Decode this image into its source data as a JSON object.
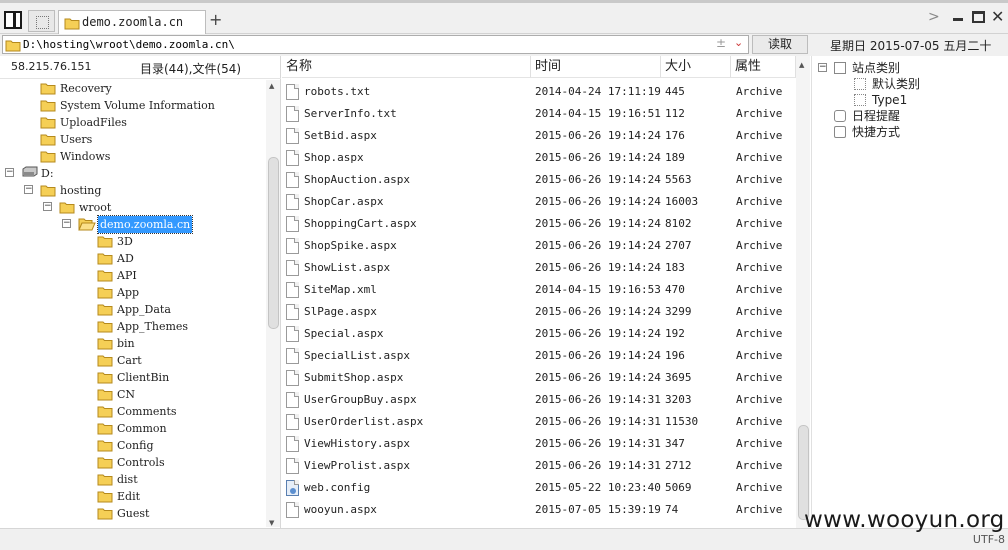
{
  "tab": {
    "label": "demo.zoomla.cn",
    "add_glyph": "+"
  },
  "window": {
    "chevron": ">",
    "close": "✕"
  },
  "address": {
    "path": "D:\\hosting\\wroot\\demo.zoomla.cn\\",
    "plus": "±",
    "dropdown": "⌄",
    "read_label": "读取"
  },
  "datetime": "星期日 2015-07-05 五月二十",
  "left": {
    "ip": "58.215.76.151",
    "count": "目录(44),文件(54)",
    "scroll_up": "▲",
    "scroll_down": "▼",
    "tree": [
      {
        "label": "Recovery",
        "depth": 2,
        "toggle": "",
        "selected": false,
        "icon": "folder"
      },
      {
        "label": "System Volume Information",
        "depth": 2,
        "toggle": "",
        "selected": false,
        "icon": "folder"
      },
      {
        "label": "UploadFiles",
        "depth": 2,
        "toggle": "",
        "selected": false,
        "icon": "folder"
      },
      {
        "label": "Users",
        "depth": 2,
        "toggle": "",
        "selected": false,
        "icon": "folder"
      },
      {
        "label": "Windows",
        "depth": 2,
        "toggle": "",
        "selected": false,
        "icon": "folder"
      },
      {
        "label": "D:",
        "depth": 1,
        "toggle": "−",
        "selected": false,
        "icon": "drive"
      },
      {
        "label": "hosting",
        "depth": 2,
        "toggle": "−",
        "selected": false,
        "icon": "folder"
      },
      {
        "label": "wroot",
        "depth": 3,
        "toggle": "−",
        "selected": false,
        "icon": "folder"
      },
      {
        "label": "demo.zoomla.cn",
        "depth": 4,
        "toggle": "−",
        "selected": true,
        "icon": "folder-open"
      },
      {
        "label": "3D",
        "depth": 5,
        "toggle": "",
        "selected": false,
        "icon": "folder"
      },
      {
        "label": "AD",
        "depth": 5,
        "toggle": "",
        "selected": false,
        "icon": "folder"
      },
      {
        "label": "API",
        "depth": 5,
        "toggle": "",
        "selected": false,
        "icon": "folder"
      },
      {
        "label": "App",
        "depth": 5,
        "toggle": "",
        "selected": false,
        "icon": "folder"
      },
      {
        "label": "App_Data",
        "depth": 5,
        "toggle": "",
        "selected": false,
        "icon": "folder"
      },
      {
        "label": "App_Themes",
        "depth": 5,
        "toggle": "",
        "selected": false,
        "icon": "folder"
      },
      {
        "label": "bin",
        "depth": 5,
        "toggle": "",
        "selected": false,
        "icon": "folder"
      },
      {
        "label": "Cart",
        "depth": 5,
        "toggle": "",
        "selected": false,
        "icon": "folder"
      },
      {
        "label": "ClientBin",
        "depth": 5,
        "toggle": "",
        "selected": false,
        "icon": "folder"
      },
      {
        "label": "CN",
        "depth": 5,
        "toggle": "",
        "selected": false,
        "icon": "folder"
      },
      {
        "label": "Comments",
        "depth": 5,
        "toggle": "",
        "selected": false,
        "icon": "folder"
      },
      {
        "label": "Common",
        "depth": 5,
        "toggle": "",
        "selected": false,
        "icon": "folder"
      },
      {
        "label": "Config",
        "depth": 5,
        "toggle": "",
        "selected": false,
        "icon": "folder"
      },
      {
        "label": "Controls",
        "depth": 5,
        "toggle": "",
        "selected": false,
        "icon": "folder"
      },
      {
        "label": "dist",
        "depth": 5,
        "toggle": "",
        "selected": false,
        "icon": "folder"
      },
      {
        "label": "Edit",
        "depth": 5,
        "toggle": "",
        "selected": false,
        "icon": "folder"
      },
      {
        "label": "Guest",
        "depth": 5,
        "toggle": "",
        "selected": false,
        "icon": "folder"
      }
    ]
  },
  "list": {
    "columns": [
      "名称",
      "时间",
      "大小",
      "属性"
    ],
    "scroll_up": "▲",
    "files": [
      {
        "name": "robots.txt",
        "time": "2014-04-24 17:11:19",
        "size": "445",
        "attr": "Archive",
        "icon": "file"
      },
      {
        "name": "ServerInfo.txt",
        "time": "2014-04-15 19:16:51",
        "size": "112",
        "attr": "Archive",
        "icon": "file"
      },
      {
        "name": "SetBid.aspx",
        "time": "2015-06-26 19:14:24",
        "size": "176",
        "attr": "Archive",
        "icon": "file"
      },
      {
        "name": "Shop.aspx",
        "time": "2015-06-26 19:14:24",
        "size": "189",
        "attr": "Archive",
        "icon": "file"
      },
      {
        "name": "ShopAuction.aspx",
        "time": "2015-06-26 19:14:24",
        "size": "5563",
        "attr": "Archive",
        "icon": "file"
      },
      {
        "name": "ShopCar.aspx",
        "time": "2015-06-26 19:14:24",
        "size": "16003",
        "attr": "Archive",
        "icon": "file"
      },
      {
        "name": "ShoppingCart.aspx",
        "time": "2015-06-26 19:14:24",
        "size": "8102",
        "attr": "Archive",
        "icon": "file"
      },
      {
        "name": "ShopSpike.aspx",
        "time": "2015-06-26 19:14:24",
        "size": "2707",
        "attr": "Archive",
        "icon": "file"
      },
      {
        "name": "ShowList.aspx",
        "time": "2015-06-26 19:14:24",
        "size": "183",
        "attr": "Archive",
        "icon": "file"
      },
      {
        "name": "SiteMap.xml",
        "time": "2014-04-15 19:16:53",
        "size": "470",
        "attr": "Archive",
        "icon": "file"
      },
      {
        "name": "SlPage.aspx",
        "time": "2015-06-26 19:14:24",
        "size": "3299",
        "attr": "Archive",
        "icon": "file"
      },
      {
        "name": "Special.aspx",
        "time": "2015-06-26 19:14:24",
        "size": "192",
        "attr": "Archive",
        "icon": "file"
      },
      {
        "name": "SpecialList.aspx",
        "time": "2015-06-26 19:14:24",
        "size": "196",
        "attr": "Archive",
        "icon": "file"
      },
      {
        "name": "SubmitShop.aspx",
        "time": "2015-06-26 19:14:24",
        "size": "3695",
        "attr": "Archive",
        "icon": "file"
      },
      {
        "name": "UserGroupBuy.aspx",
        "time": "2015-06-26 19:14:31",
        "size": "3203",
        "attr": "Archive",
        "icon": "file"
      },
      {
        "name": "UserOrderlist.aspx",
        "time": "2015-06-26 19:14:31",
        "size": "11530",
        "attr": "Archive",
        "icon": "file"
      },
      {
        "name": "ViewHistory.aspx",
        "time": "2015-06-26 19:14:31",
        "size": "347",
        "attr": "Archive",
        "icon": "file"
      },
      {
        "name": "ViewProlist.aspx",
        "time": "2015-06-26 19:14:31",
        "size": "2712",
        "attr": "Archive",
        "icon": "file"
      },
      {
        "name": "web.config",
        "time": "2015-05-22 10:23:40",
        "size": "5069",
        "attr": "Archive",
        "icon": "config"
      },
      {
        "name": "wooyun.aspx",
        "time": "2015-07-05 15:39:19",
        "size": "74",
        "attr": "Archive",
        "icon": "file"
      }
    ]
  },
  "right": {
    "items": [
      {
        "label": "站点类别",
        "toggle": "−",
        "icon": "site-category",
        "depth": 0
      },
      {
        "label": "默认类别",
        "toggle": "",
        "icon": "category",
        "depth": 1
      },
      {
        "label": "Type1",
        "toggle": "",
        "icon": "category",
        "depth": 1
      },
      {
        "label": "日程提醒",
        "toggle": "",
        "icon": "schedule",
        "depth": 0
      },
      {
        "label": "快捷方式",
        "toggle": "",
        "icon": "shortcut",
        "depth": 0
      }
    ]
  },
  "status": {
    "encoding": "UTF-8"
  },
  "watermark": "www.wooyun.org"
}
